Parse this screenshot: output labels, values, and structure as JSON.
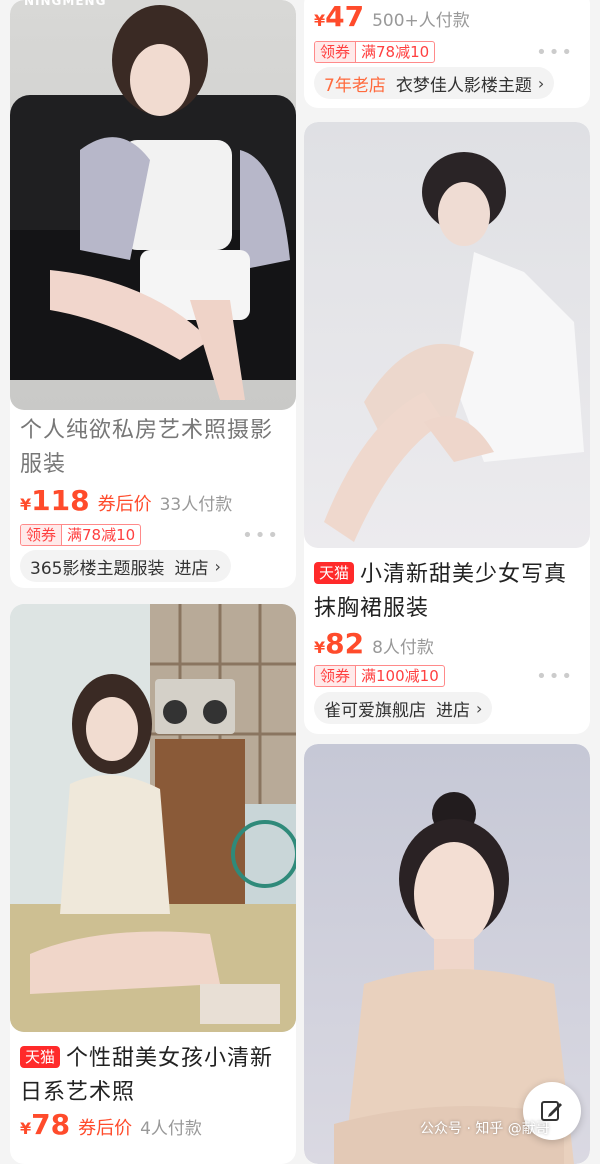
{
  "cards": [
    {
      "title": "个人纯欲私房艺术照摄影服装",
      "title_line1": "个人纯欲私房艺术照摄影",
      "title_line2": "服装",
      "currency": "¥",
      "price": "118",
      "price_note": "券后价",
      "sold": "33人付款",
      "coupon_key": "领券",
      "coupon_value": "满78减10",
      "shop": "365影楼主题服装",
      "shop_link": "进店",
      "image_brand": "NINGMENG"
    },
    {
      "currency": "¥",
      "price": "47",
      "sold": "500+人付款",
      "coupon_key": "领券",
      "coupon_value": "满78减10",
      "shop_badge": "7年老店",
      "shop": "衣梦佳人影楼主题"
    },
    {
      "badge": "天猫",
      "title_line1": "小清新甜美少女写真",
      "title_line2": "抹胸裙服装",
      "currency": "¥",
      "price": "82",
      "sold": "8人付款",
      "coupon_key": "领券",
      "coupon_value": "满100减10",
      "shop": "雀可爱旗舰店",
      "shop_link": "进店"
    },
    {
      "badge": "天猫",
      "title_line1": "个性甜美女孩小清新",
      "title_line2": "日系艺术照",
      "currency": "¥",
      "price": "78",
      "price_note": "券后价",
      "sold": "4人付款"
    },
    {}
  ],
  "more_icon": "ellipsis-icon",
  "chevron": "›",
  "watermark": "公众号 · 知乎 @献哥",
  "colors": {
    "accent": "#ff4b2b",
    "tmall": "#ff2a2a",
    "page_bg": "#f4f4f4"
  }
}
